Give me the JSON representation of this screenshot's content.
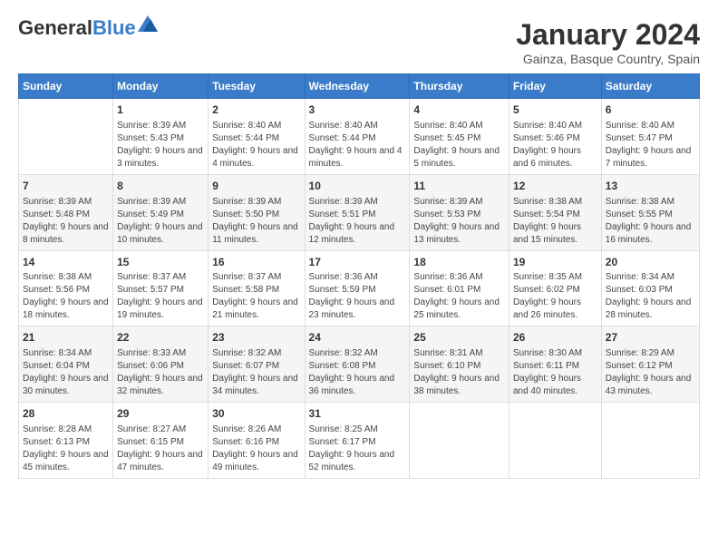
{
  "logo": {
    "line1": "General",
    "line2": "Blue"
  },
  "title": "January 2024",
  "subtitle": "Gainza, Basque Country, Spain",
  "headers": [
    "Sunday",
    "Monday",
    "Tuesday",
    "Wednesday",
    "Thursday",
    "Friday",
    "Saturday"
  ],
  "weeks": [
    [
      {
        "day": "",
        "sunrise": "",
        "sunset": "",
        "daylight": ""
      },
      {
        "day": "1",
        "sunrise": "Sunrise: 8:39 AM",
        "sunset": "Sunset: 5:43 PM",
        "daylight": "Daylight: 9 hours and 3 minutes."
      },
      {
        "day": "2",
        "sunrise": "Sunrise: 8:40 AM",
        "sunset": "Sunset: 5:44 PM",
        "daylight": "Daylight: 9 hours and 4 minutes."
      },
      {
        "day": "3",
        "sunrise": "Sunrise: 8:40 AM",
        "sunset": "Sunset: 5:44 PM",
        "daylight": "Daylight: 9 hours and 4 minutes."
      },
      {
        "day": "4",
        "sunrise": "Sunrise: 8:40 AM",
        "sunset": "Sunset: 5:45 PM",
        "daylight": "Daylight: 9 hours and 5 minutes."
      },
      {
        "day": "5",
        "sunrise": "Sunrise: 8:40 AM",
        "sunset": "Sunset: 5:46 PM",
        "daylight": "Daylight: 9 hours and 6 minutes."
      },
      {
        "day": "6",
        "sunrise": "Sunrise: 8:40 AM",
        "sunset": "Sunset: 5:47 PM",
        "daylight": "Daylight: 9 hours and 7 minutes."
      }
    ],
    [
      {
        "day": "7",
        "sunrise": "Sunrise: 8:39 AM",
        "sunset": "Sunset: 5:48 PM",
        "daylight": "Daylight: 9 hours and 8 minutes."
      },
      {
        "day": "8",
        "sunrise": "Sunrise: 8:39 AM",
        "sunset": "Sunset: 5:49 PM",
        "daylight": "Daylight: 9 hours and 10 minutes."
      },
      {
        "day": "9",
        "sunrise": "Sunrise: 8:39 AM",
        "sunset": "Sunset: 5:50 PM",
        "daylight": "Daylight: 9 hours and 11 minutes."
      },
      {
        "day": "10",
        "sunrise": "Sunrise: 8:39 AM",
        "sunset": "Sunset: 5:51 PM",
        "daylight": "Daylight: 9 hours and 12 minutes."
      },
      {
        "day": "11",
        "sunrise": "Sunrise: 8:39 AM",
        "sunset": "Sunset: 5:53 PM",
        "daylight": "Daylight: 9 hours and 13 minutes."
      },
      {
        "day": "12",
        "sunrise": "Sunrise: 8:38 AM",
        "sunset": "Sunset: 5:54 PM",
        "daylight": "Daylight: 9 hours and 15 minutes."
      },
      {
        "day": "13",
        "sunrise": "Sunrise: 8:38 AM",
        "sunset": "Sunset: 5:55 PM",
        "daylight": "Daylight: 9 hours and 16 minutes."
      }
    ],
    [
      {
        "day": "14",
        "sunrise": "Sunrise: 8:38 AM",
        "sunset": "Sunset: 5:56 PM",
        "daylight": "Daylight: 9 hours and 18 minutes."
      },
      {
        "day": "15",
        "sunrise": "Sunrise: 8:37 AM",
        "sunset": "Sunset: 5:57 PM",
        "daylight": "Daylight: 9 hours and 19 minutes."
      },
      {
        "day": "16",
        "sunrise": "Sunrise: 8:37 AM",
        "sunset": "Sunset: 5:58 PM",
        "daylight": "Daylight: 9 hours and 21 minutes."
      },
      {
        "day": "17",
        "sunrise": "Sunrise: 8:36 AM",
        "sunset": "Sunset: 5:59 PM",
        "daylight": "Daylight: 9 hours and 23 minutes."
      },
      {
        "day": "18",
        "sunrise": "Sunrise: 8:36 AM",
        "sunset": "Sunset: 6:01 PM",
        "daylight": "Daylight: 9 hours and 25 minutes."
      },
      {
        "day": "19",
        "sunrise": "Sunrise: 8:35 AM",
        "sunset": "Sunset: 6:02 PM",
        "daylight": "Daylight: 9 hours and 26 minutes."
      },
      {
        "day": "20",
        "sunrise": "Sunrise: 8:34 AM",
        "sunset": "Sunset: 6:03 PM",
        "daylight": "Daylight: 9 hours and 28 minutes."
      }
    ],
    [
      {
        "day": "21",
        "sunrise": "Sunrise: 8:34 AM",
        "sunset": "Sunset: 6:04 PM",
        "daylight": "Daylight: 9 hours and 30 minutes."
      },
      {
        "day": "22",
        "sunrise": "Sunrise: 8:33 AM",
        "sunset": "Sunset: 6:06 PM",
        "daylight": "Daylight: 9 hours and 32 minutes."
      },
      {
        "day": "23",
        "sunrise": "Sunrise: 8:32 AM",
        "sunset": "Sunset: 6:07 PM",
        "daylight": "Daylight: 9 hours and 34 minutes."
      },
      {
        "day": "24",
        "sunrise": "Sunrise: 8:32 AM",
        "sunset": "Sunset: 6:08 PM",
        "daylight": "Daylight: 9 hours and 36 minutes."
      },
      {
        "day": "25",
        "sunrise": "Sunrise: 8:31 AM",
        "sunset": "Sunset: 6:10 PM",
        "daylight": "Daylight: 9 hours and 38 minutes."
      },
      {
        "day": "26",
        "sunrise": "Sunrise: 8:30 AM",
        "sunset": "Sunset: 6:11 PM",
        "daylight": "Daylight: 9 hours and 40 minutes."
      },
      {
        "day": "27",
        "sunrise": "Sunrise: 8:29 AM",
        "sunset": "Sunset: 6:12 PM",
        "daylight": "Daylight: 9 hours and 43 minutes."
      }
    ],
    [
      {
        "day": "28",
        "sunrise": "Sunrise: 8:28 AM",
        "sunset": "Sunset: 6:13 PM",
        "daylight": "Daylight: 9 hours and 45 minutes."
      },
      {
        "day": "29",
        "sunrise": "Sunrise: 8:27 AM",
        "sunset": "Sunset: 6:15 PM",
        "daylight": "Daylight: 9 hours and 47 minutes."
      },
      {
        "day": "30",
        "sunrise": "Sunrise: 8:26 AM",
        "sunset": "Sunset: 6:16 PM",
        "daylight": "Daylight: 9 hours and 49 minutes."
      },
      {
        "day": "31",
        "sunrise": "Sunrise: 8:25 AM",
        "sunset": "Sunset: 6:17 PM",
        "daylight": "Daylight: 9 hours and 52 minutes."
      },
      {
        "day": "",
        "sunrise": "",
        "sunset": "",
        "daylight": ""
      },
      {
        "day": "",
        "sunrise": "",
        "sunset": "",
        "daylight": ""
      },
      {
        "day": "",
        "sunrise": "",
        "sunset": "",
        "daylight": ""
      }
    ]
  ],
  "colors": {
    "header_bg": "#3a7cc9",
    "header_text": "#ffffff",
    "row_even": "#f5f5f5",
    "row_odd": "#ffffff"
  }
}
